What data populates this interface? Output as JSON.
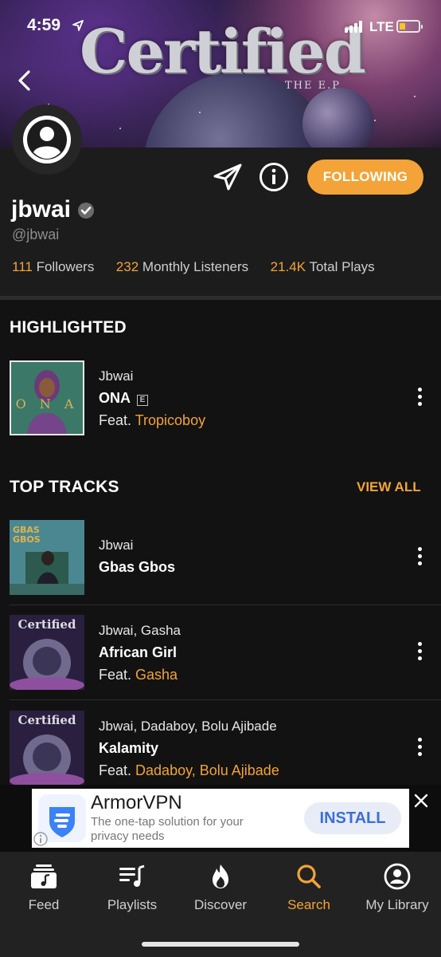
{
  "status_bar": {
    "time": "4:59",
    "network": "LTE"
  },
  "banner": {
    "title": "Certified",
    "subtitle": "THE E.P"
  },
  "profile": {
    "name": "jbwai",
    "handle": "@jbwai",
    "follow_label": "FOLLOWING",
    "stats": {
      "followers_value": "111",
      "followers_label": "Followers",
      "listeners_value": "232",
      "listeners_label": "Monthly Listeners",
      "plays_value": "21.4K",
      "plays_label": "Total Plays"
    }
  },
  "highlighted": {
    "section_title": "HIGHLIGHTED",
    "track": {
      "artist": "Jbwai",
      "title": "ONA",
      "explicit": "E",
      "feat_prefix": "Feat. ",
      "feat": "Tropicoboy",
      "cover_text": "O N A"
    }
  },
  "top_tracks": {
    "section_title": "TOP TRACKS",
    "view_all": "VIEW ALL",
    "items": [
      {
        "artist": "Jbwai",
        "title": "Gbas Gbos",
        "feat_prefix": "",
        "feat": "",
        "cover_text": "GBAS GBOS"
      },
      {
        "artist": "Jbwai, Gasha",
        "title": "African Girl",
        "feat_prefix": "Feat. ",
        "feat": "Gasha",
        "cover_text": "Certified"
      },
      {
        "artist": "Jbwai, Dadaboy, Bolu Ajibade",
        "title": "Kalamity",
        "feat_prefix": "Feat. ",
        "feat": "Dadaboy, Bolu Ajibade",
        "cover_text": "Certified"
      }
    ]
  },
  "ad": {
    "title": "ArmorVPN",
    "description": "The one-tap solution for your privacy needs",
    "install_label": "INSTALL"
  },
  "tabs": [
    {
      "label": "Feed",
      "icon": "music-feed-icon"
    },
    {
      "label": "Playlists",
      "icon": "playlist-icon"
    },
    {
      "label": "Discover",
      "icon": "flame-icon"
    },
    {
      "label": "Search",
      "icon": "search-icon"
    },
    {
      "label": "My Library",
      "icon": "library-icon"
    }
  ],
  "colors": {
    "accent": "#f3a338",
    "background": "#121212",
    "header_bg": "#1c1c1c"
  }
}
